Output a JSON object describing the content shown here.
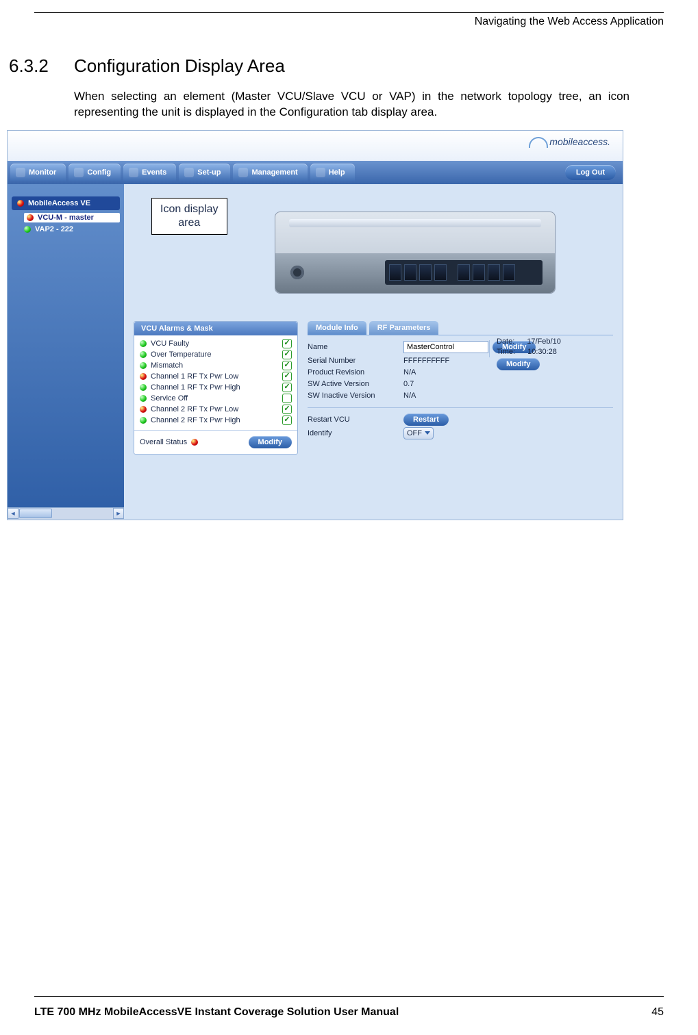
{
  "header": {
    "running": "Navigating the Web Access Application"
  },
  "section": {
    "number": "6.3.2",
    "title": "Configuration Display Area",
    "paragraph": "When selecting an element (Master VCU/Slave VCU or VAP) in the network topology tree, an icon representing the unit is displayed in the Configuration tab display area."
  },
  "footer": {
    "title": "LTE 700 MHz MobileAccessVE Instant Coverage Solution User Manual",
    "page": "45"
  },
  "app": {
    "brand": "mobileaccess.",
    "tabs": [
      "Monitor",
      "Config",
      "Events",
      "Set-up",
      "Management",
      "Help"
    ],
    "logout": "Log Out"
  },
  "tree": {
    "root": "MobileAccess VE",
    "items": [
      {
        "label": "VCU-M - master",
        "status": "red",
        "selected": true
      },
      {
        "label": "VAP2 - 222",
        "status": "green",
        "selected": false
      }
    ]
  },
  "callout": {
    "line1": "Icon display",
    "line2": "area"
  },
  "alarms": {
    "title": "VCU Alarms & Mask",
    "rows": [
      {
        "status": "green",
        "label": "VCU Faulty",
        "checked": true
      },
      {
        "status": "green",
        "label": "Over Temperature",
        "checked": true
      },
      {
        "status": "green",
        "label": "Mismatch",
        "checked": true
      },
      {
        "status": "red",
        "label": "Channel 1 RF Tx Pwr Low",
        "checked": true
      },
      {
        "status": "green",
        "label": "Channel 1 RF Tx Pwr High",
        "checked": true
      },
      {
        "status": "green",
        "label": "Service Off",
        "checked": false
      },
      {
        "status": "red",
        "label": "Channel 2 RF Tx Pwr Low",
        "checked": true
      },
      {
        "status": "green",
        "label": "Channel 2 RF Tx Pwr High",
        "checked": true
      }
    ],
    "overall_label": "Overall Status",
    "overall_status": "red",
    "modify": "Modify"
  },
  "module_info": {
    "tabs": {
      "active": "Module Info",
      "other": "RF Parameters"
    },
    "fields": {
      "name_label": "Name",
      "name_value": "MasterControl",
      "modify": "Modify",
      "serial_label": "Serial Number",
      "serial_value": "FFFFFFFFFF",
      "rev_label": "Product Revision",
      "rev_value": "N/A",
      "sw_active_label": "SW Active Version",
      "sw_active_value": "0.7",
      "sw_inactive_label": "SW Inactive Version",
      "sw_inactive_value": "N/A",
      "restart_label": "Restart VCU",
      "restart_btn": "Restart",
      "identify_label": "Identify",
      "identify_value": "OFF"
    }
  },
  "datetime": {
    "date_label": "Date:",
    "date_value": "17/Feb/10",
    "time_label": "Time:",
    "time_value": "10:30:28",
    "modify": "Modify"
  }
}
